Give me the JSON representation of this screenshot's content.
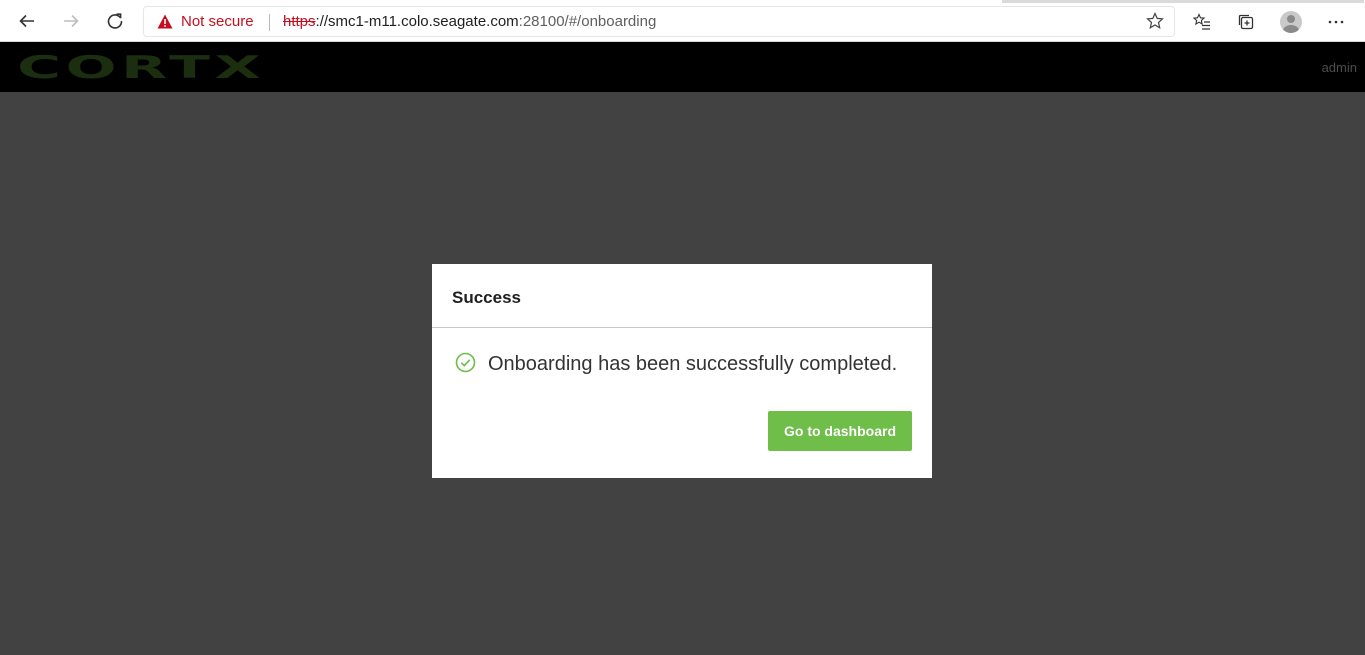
{
  "browser": {
    "security_label": "Not secure",
    "url_scheme": "https",
    "url_host": "://smc1-m11.colo.seagate.com",
    "url_rest": ":28100/#/onboarding",
    "icons": {
      "back": "arrow-left-icon",
      "forward": "arrow-right-icon",
      "reload": "reload-icon",
      "warning": "warning-triangle-icon",
      "favorite": "star-icon",
      "favorites_list": "favorites-list-icon",
      "collections": "collections-icon",
      "profile": "profile-avatar-icon",
      "more": "more-dots-icon"
    },
    "warning_color": "#c50f1f"
  },
  "app_header": {
    "logo_text": "CORTX",
    "user": "admin",
    "logo_color": "#1b2e10"
  },
  "dialog": {
    "title": "Success",
    "message": "Onboarding has been successfully completed.",
    "button_label": "Go to dashboard",
    "accent_color": "#6ebe49",
    "status_icon": "check-circle-icon"
  }
}
